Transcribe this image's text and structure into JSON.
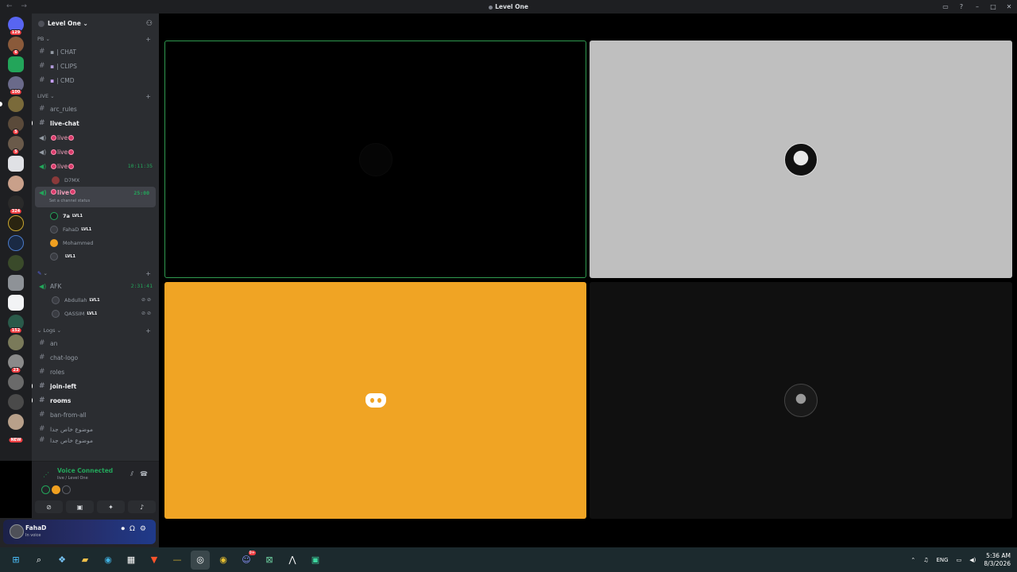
{
  "window": {
    "title": "Level One",
    "nav": "← →"
  },
  "guilds": [
    {
      "badge": "129"
    },
    {
      "badge": "6"
    },
    {
      "badge": ""
    },
    {
      "badge": "100"
    },
    {
      "badge": ""
    },
    {
      "badge": "5"
    },
    {
      "badge": "5"
    },
    {
      "badge": ""
    },
    {
      "badge": ""
    },
    {
      "badge": "324"
    },
    {
      "badge": ""
    },
    {
      "badge": ""
    },
    {
      "badge": ""
    },
    {
      "badge": ""
    },
    {
      "badge": ""
    },
    {
      "badge": "152"
    },
    {
      "badge": ""
    },
    {
      "badge": "23"
    },
    {
      "badge": ""
    },
    {
      "badge": ""
    },
    {
      "badge": ""
    },
    {
      "badge": "NEW"
    }
  ],
  "server": {
    "name": "Level One"
  },
  "categories": {
    "pb": "PB",
    "live": "LIVE",
    "logs": "Logs"
  },
  "pb_channels": [
    "| CHAT",
    "| CLIPS",
    "| CMD"
  ],
  "live": {
    "rules": "arc_rules",
    "live_chat": "live-chat",
    "voice_label": "live",
    "time1": "10:11:35",
    "member_d7mx": "D7MX",
    "active_time": "25:00",
    "active_status": "Set a channel status",
    "members": [
      {
        "name": "7a",
        "lvl": "LVL1"
      },
      {
        "name": "FahaD",
        "lvl": "LVL1"
      },
      {
        "name": "Mohammed",
        "lvl": ""
      },
      {
        "name": "",
        "lvl": "LVL1"
      }
    ]
  },
  "afk": {
    "name": "AFK",
    "time": "2:31:41",
    "members": [
      {
        "name": "Abdullah",
        "lvl": "LVL1"
      },
      {
        "name": "QASSIM",
        "lvl": "LVL1"
      }
    ]
  },
  "logs_channels": [
    "an",
    "chat-logo",
    "roles",
    "join-left",
    "rooms",
    "ban-from-all",
    "موضوع خاص جدا",
    "موضوع خاص جدا"
  ],
  "voice": {
    "title": "Voice Connected",
    "sub": "live / Level One"
  },
  "user": {
    "name": "FahaD",
    "status": "In voice"
  },
  "taskbar": {
    "time": "5:36 AM",
    "date": "8/3/2026",
    "lang": "ENG",
    "discord_badge": "9+"
  },
  "colors": {
    "accent_green": "#23a55a",
    "speaking_border": "#2f9a4f",
    "tile_orange": "#f0a424",
    "tile_grey": "#bfbfbf"
  }
}
